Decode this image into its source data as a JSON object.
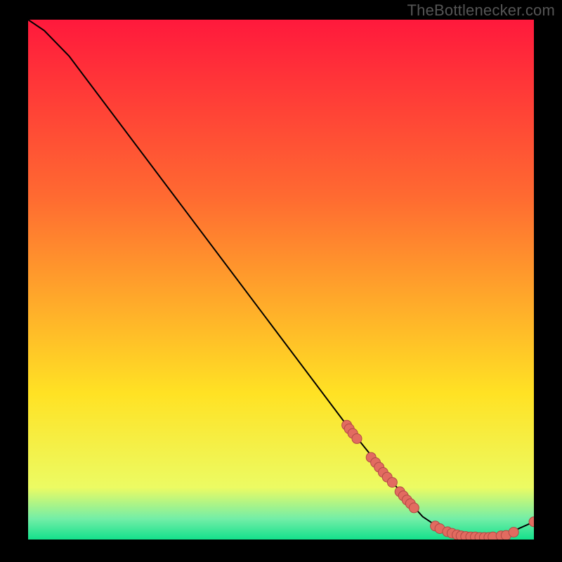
{
  "attribution": "TheBottlenecker.com",
  "chart_data": {
    "type": "line",
    "title": "",
    "xlabel": "",
    "ylabel": "",
    "xlim": [
      0,
      100
    ],
    "ylim": [
      0,
      100
    ],
    "curve_points": [
      [
        0.0,
        100.0
      ],
      [
        3.2,
        97.9
      ],
      [
        8.1,
        93.0
      ],
      [
        63.0,
        22.0
      ],
      [
        74.0,
        8.7
      ],
      [
        78.0,
        4.4
      ],
      [
        82.0,
        1.8
      ],
      [
        86.0,
        0.6
      ],
      [
        90.0,
        0.4
      ],
      [
        94.0,
        0.8
      ],
      [
        100.0,
        3.4
      ]
    ],
    "markers": [
      [
        63.0,
        22.0
      ],
      [
        63.5,
        21.3
      ],
      [
        64.2,
        20.4
      ],
      [
        65.0,
        19.4
      ],
      [
        67.8,
        15.8
      ],
      [
        68.7,
        14.8
      ],
      [
        69.4,
        13.9
      ],
      [
        70.2,
        12.9
      ],
      [
        71.0,
        12.0
      ],
      [
        72.0,
        11.0
      ],
      [
        73.5,
        9.2
      ],
      [
        74.2,
        8.4
      ],
      [
        74.9,
        7.6
      ],
      [
        75.6,
        6.9
      ],
      [
        76.3,
        6.1
      ],
      [
        80.5,
        2.6
      ],
      [
        81.4,
        2.1
      ],
      [
        82.9,
        1.5
      ],
      [
        83.8,
        1.2
      ],
      [
        84.8,
        0.9
      ],
      [
        85.6,
        0.7
      ],
      [
        86.5,
        0.6
      ],
      [
        87.5,
        0.5
      ],
      [
        88.4,
        0.5
      ],
      [
        89.3,
        0.4
      ],
      [
        90.2,
        0.4
      ],
      [
        91.1,
        0.4
      ],
      [
        91.9,
        0.5
      ],
      [
        93.5,
        0.7
      ],
      [
        94.5,
        0.8
      ],
      [
        96.0,
        1.4
      ],
      [
        100.0,
        3.4
      ]
    ],
    "gradient_top": "#ff193c",
    "gradient_mid_upper": "#ff6a31",
    "gradient_mid": "#ffe224",
    "gradient_near_bottom": "#ecfb63",
    "gradient_green_a": "#73eea7",
    "gradient_green_b": "#13e18c",
    "marker_fill": "#e26b60",
    "marker_stroke": "#b24a45",
    "line_color": "#000000"
  }
}
